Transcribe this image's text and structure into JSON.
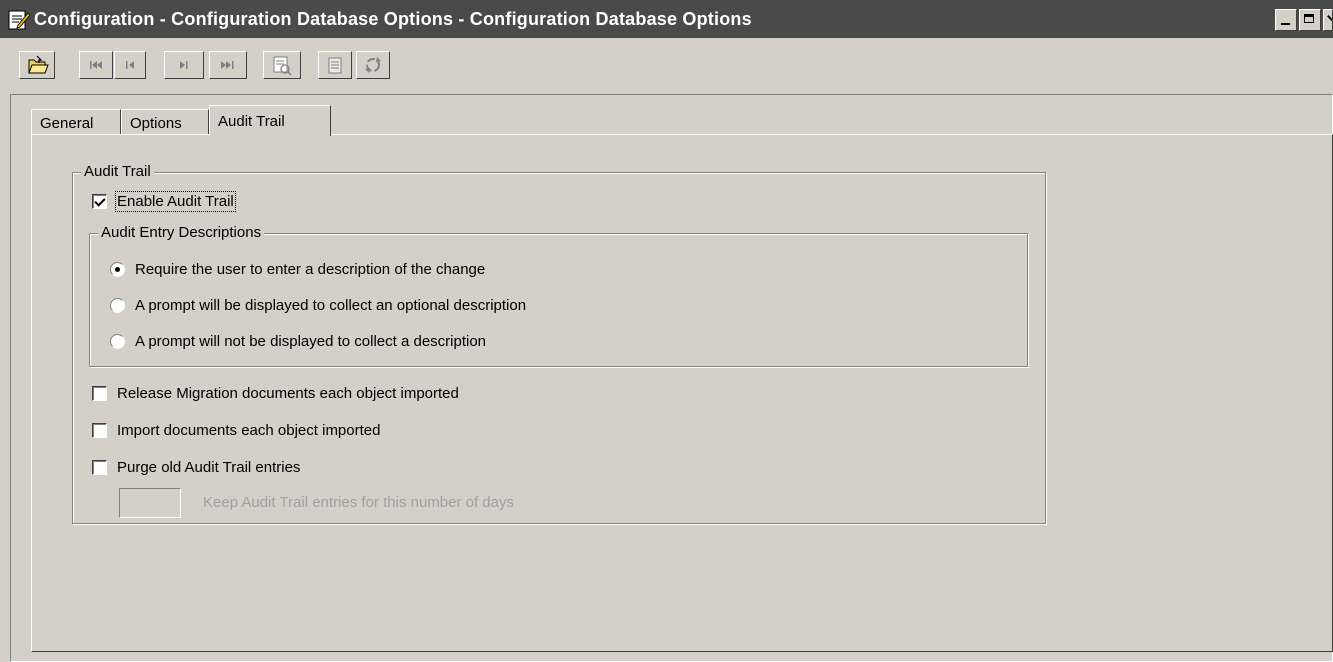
{
  "window": {
    "title": "Configuration - Configuration Database Options - Configuration Database Options",
    "app_icon": "notepad-edit-icon"
  },
  "toolbar": {
    "buttons": [
      {
        "icon": "open-folder-icon"
      },
      {
        "icon": "first-record-icon"
      },
      {
        "icon": "previous-record-icon"
      },
      {
        "icon": "next-record-icon"
      },
      {
        "icon": "last-record-icon"
      },
      {
        "icon": "print-preview-icon"
      },
      {
        "icon": "properties-icon"
      },
      {
        "icon": "refresh-icon"
      }
    ]
  },
  "tabs": [
    {
      "label": "General",
      "active": false
    },
    {
      "label": "Options",
      "active": false
    },
    {
      "label": "Audit Trail",
      "active": true
    }
  ],
  "audit_trail": {
    "group_label": "Audit Trail",
    "enable_label": "Enable Audit Trail",
    "enable_checked": true,
    "descriptions": {
      "group_label": "Audit Entry Descriptions",
      "options": [
        {
          "label": "Require the user to enter a description of the change",
          "selected": true
        },
        {
          "label": "A prompt will be displayed to collect an optional description",
          "selected": false
        },
        {
          "label": "A prompt will not be displayed to collect a description",
          "selected": false
        }
      ]
    },
    "release_migration_label": "Release Migration documents each object imported",
    "release_migration_checked": false,
    "import_documents_label": "Import documents each object imported",
    "import_documents_checked": false,
    "purge_label": "Purge old Audit Trail entries",
    "purge_checked": false,
    "keep_days_label": "Keep Audit Trail entries for this number of days",
    "keep_days_value": ""
  }
}
